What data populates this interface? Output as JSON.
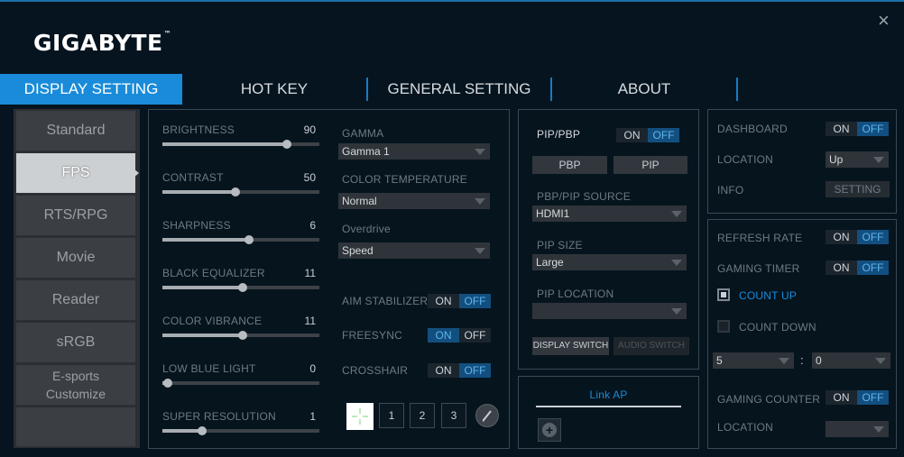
{
  "window": {
    "logo": "GIGABYTE",
    "trademark": "™",
    "close_glyph": "×"
  },
  "tabs": [
    {
      "label": "DISPLAY SETTING"
    },
    {
      "label": "HOT KEY"
    },
    {
      "label": "GENERAL SETTING"
    },
    {
      "label": "ABOUT"
    }
  ],
  "modes": [
    {
      "label": "Standard"
    },
    {
      "label": "FPS"
    },
    {
      "label": "RTS/RPG"
    },
    {
      "label": "Movie"
    },
    {
      "label": "Reader"
    },
    {
      "label": "sRGB"
    },
    {
      "label": "E-sports\nCustomize"
    }
  ],
  "sliders": [
    {
      "label": "BRIGHTNESS",
      "value": "90",
      "fraction": 0.88
    },
    {
      "label": "CONTRAST",
      "value": "50",
      "fraction": 0.5
    },
    {
      "label": "SHARPNESS",
      "value": "6",
      "fraction": 0.6
    },
    {
      "label": "BLACK EQUALIZER",
      "value": "11",
      "fraction": 0.55
    },
    {
      "label": "COLOR VIBRANCE",
      "value": "11",
      "fraction": 0.55
    },
    {
      "label": "LOW BLUE LIGHT",
      "value": "0",
      "fraction": 0.0
    },
    {
      "label": "SUPER RESOLUTION",
      "value": "1",
      "fraction": 0.25
    }
  ],
  "picture": {
    "gamma": {
      "label": "GAMMA",
      "value": "Gamma 1"
    },
    "color_temp": {
      "label": "COLOR TEMPERATURE",
      "value": "Normal"
    },
    "overdrive": {
      "label": "Overdrive",
      "value": "Speed"
    },
    "aim_stabilizer": {
      "label": "AIM STABILIZER",
      "on": "ON",
      "off": "OFF",
      "state": "off"
    },
    "freesync": {
      "label": "FREESYNC",
      "on": "ON",
      "off": "OFF",
      "state": "on"
    },
    "crosshair": {
      "label": "CROSSHAIR",
      "on": "ON",
      "off": "OFF",
      "state": "off"
    },
    "crosshair_slots": [
      "1",
      "2",
      "3"
    ]
  },
  "pip": {
    "label": "PIP/PBP",
    "on": "ON",
    "off": "OFF",
    "state": "off",
    "pbp_button": "PBP",
    "pip_button": "PIP",
    "source_label": "PBP/PIP SOURCE",
    "source_value": "HDMI1",
    "size_label": "PIP SIZE",
    "size_value": "Large",
    "location_label": "PIP LOCATION",
    "location_value": "",
    "display_switch": "DISPLAY SWITCH",
    "audio_switch": "AUDIO SWITCH"
  },
  "link": {
    "label": "Link AP",
    "add_glyph": "+"
  },
  "dashboard": {
    "label": "DASHBOARD",
    "on": "ON",
    "off": "OFF",
    "state": "off",
    "location_label": "LOCATION",
    "location_value": "Up",
    "info_label": "INFO",
    "setting_button": "SETTING"
  },
  "gaming": {
    "refresh_rate": {
      "label": "REFRESH RATE",
      "on": "ON",
      "off": "OFF",
      "state": "off"
    },
    "timer": {
      "label": "GAMING TIMER",
      "on": "ON",
      "off": "OFF",
      "state": "off"
    },
    "count_up": "COUNT UP",
    "count_down": "COUNT DOWN",
    "minutes": "5",
    "separator": ":",
    "seconds": "0",
    "counter": {
      "label": "GAMING COUNTER",
      "on": "ON",
      "off": "OFF",
      "state": "off"
    },
    "location_label": "LOCATION",
    "location_value": ""
  },
  "colors": {
    "accent": "#1a8bd9",
    "toggle_on_bg": "#124f7f",
    "toggle_on_text": "#5fb4ee",
    "background": "#05141f"
  }
}
